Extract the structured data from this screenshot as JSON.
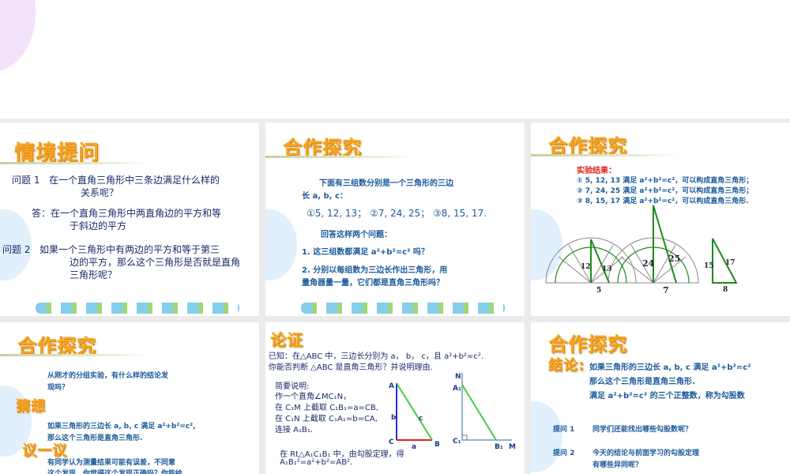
{
  "slides": [
    {
      "title": "情境提问",
      "q1_label": "问题 1",
      "q1_l1": "在一个直角三角形中三条边满足什么样的",
      "q1_l2": "关系呢？",
      "ans_l1": "答：在一个直角三角形中两直角边的平方和等",
      "ans_l2": "于斜边的平方",
      "q2_label": "问题 2",
      "q2_l1": "如果一个三角形中有两边的平方和等于第三",
      "q2_l2": "边的平方，那么这个三角形是否就是直角",
      "q2_l3": "三角形呢？"
    },
    {
      "title": "合作探究",
      "intro_l1": "下面有三组数分别是一个三角形的三边",
      "intro_l2": "长 a, b, c：",
      "groups": "①5, 12, 13；  ②7, 24, 25；  ③8, 15, 17.",
      "prompt": "回答这样两个问题：",
      "q1": "1. 这三组数都满足  a²+b²=c² 吗？",
      "q2_l1": "2. 分别以每组数为三边长作出三角形，用",
      "q2_l2": "量角器量一量，它们都是直角三角形吗？"
    },
    {
      "title": "合作探究",
      "result_label": "实验结果：",
      "r1": "① 5, 12, 13 满足 a²+b²=c²，可以构成直角三角形；",
      "r2": "② 7, 24, 25 满足 a²+b²=c²，可以构成直角三角形；",
      "r3": "③ 8, 15, 17 满足 a²+b²=c²，可以构成直角三角形.",
      "labels": {
        "t1a": "12",
        "t1b": "13",
        "t1c": "5",
        "t2a": "24",
        "t2b": "25",
        "t2c": "7",
        "t3a": "15",
        "t3b": "17",
        "t3c": "8"
      }
    },
    {
      "title": "合作探究",
      "q_l1": "从刚才的分组实验，有什么样的结论发",
      "q_l2": "现吗？",
      "guess": "猜想",
      "guess_l1": "如果三角形的三边长 a, b, c 满足 a²+b²=c²,",
      "guess_l2": "那么这个三角形是直角三角形.",
      "discuss": "议一议",
      "disc_l1": "有同学认为测量结果可能有误差，不同意",
      "disc_l2": "这个发现，你觉得这个发现正确吗？你能给"
    },
    {
      "title": "论证",
      "given_l1": "已知：在△ABC 中，三边长分别为 a， b， c，且 a²+b²=c².",
      "given_l2": "你能否判断 △ABC 是直角三角形？并说明理由.",
      "brief": "简要说明:",
      "s1": "作一个直角∠MC₁N，",
      "s2": "在 C₁M 上截取 C₁B₁=a=CB,",
      "s3": "在 C₁N 上截取 C₁A₁=b=CA,",
      "s4": "连接 A₁B₁.",
      "s5": "在 Rt△A₁C₁B₁ 中，由勾股定理，得",
      "s6": "A₁B₁²=a²+b²=AB².",
      "fig": {
        "A": "A",
        "B": "B",
        "C": "C",
        "a": "a",
        "b": "b",
        "c": "c",
        "N": "N",
        "A1": "A₁",
        "C1": "C₁",
        "B1": "B₁",
        "M": "M"
      }
    },
    {
      "title": "合作探究",
      "concl": "结论:",
      "c_l1": "如果三角形的三边长 a, b, c 满足 a²+b²=c²",
      "c_l2": "那么这个三角形是直角三角形.",
      "c_l3": "满足 a²+b²=c² 的三个正整数，称为勾股数",
      "p1_label": "提问 1",
      "p1": "同学们还能找出哪些勾股数呢？",
      "p2_label": "提问 2",
      "p2_l1": "今天的结论与前面学习的勾股定理",
      "p2_l2": "有哪些异同呢？"
    }
  ],
  "colors": {
    "title": "#f5a623",
    "body": "#1b5a9a",
    "red": "#e02020",
    "green": "#1e8a1e"
  }
}
